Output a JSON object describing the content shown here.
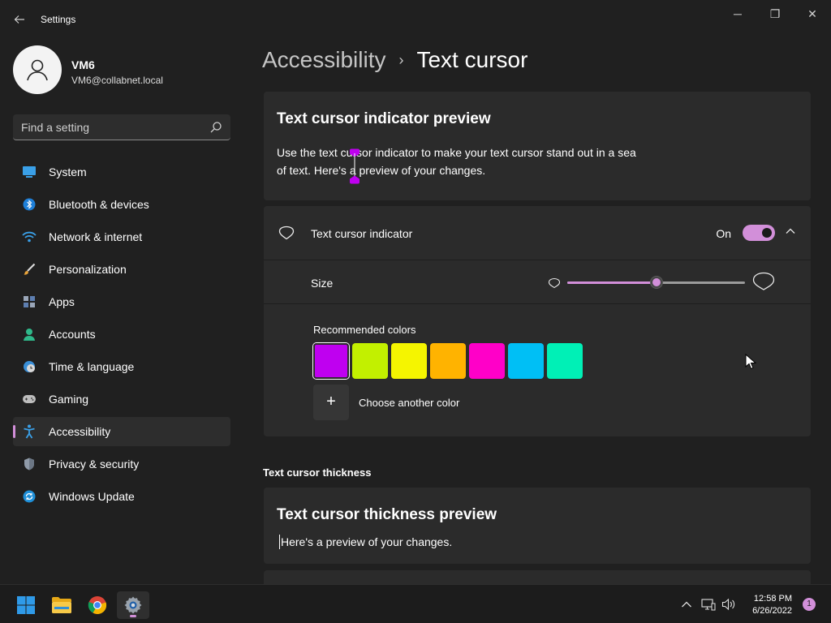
{
  "window": {
    "title": "Settings",
    "back_icon": "back-arrow-icon",
    "minimize_glyph": "─",
    "maximize_glyph": "❐",
    "close_glyph": "✕"
  },
  "profile": {
    "name": "VM6",
    "email": "VM6@collabnet.local"
  },
  "search": {
    "placeholder": "Find a setting"
  },
  "sidebar": {
    "items": [
      {
        "label": "System",
        "icon": "system-icon"
      },
      {
        "label": "Bluetooth & devices",
        "icon": "bluetooth-icon"
      },
      {
        "label": "Network & internet",
        "icon": "network-icon"
      },
      {
        "label": "Personalization",
        "icon": "brush-icon"
      },
      {
        "label": "Apps",
        "icon": "apps-icon"
      },
      {
        "label": "Accounts",
        "icon": "accounts-icon"
      },
      {
        "label": "Time & language",
        "icon": "clock-globe-icon"
      },
      {
        "label": "Gaming",
        "icon": "gamepad-icon"
      },
      {
        "label": "Accessibility",
        "icon": "accessibility-icon",
        "selected": true
      },
      {
        "label": "Privacy & security",
        "icon": "shield-icon"
      },
      {
        "label": "Windows Update",
        "icon": "update-icon"
      }
    ]
  },
  "breadcrumb": {
    "parent": "Accessibility",
    "separator": "›",
    "current": "Text cursor"
  },
  "preview_card": {
    "title": "Text cursor indicator preview",
    "line1": "Use the text cursor indicator to make your text cursor stand out in a sea",
    "line2": "of text. Here's a preview of your changes."
  },
  "indicator_row": {
    "label": "Text cursor indicator",
    "state_text": "On",
    "enabled": true
  },
  "size_row": {
    "label": "Size",
    "value_fraction": 0.5
  },
  "colors": {
    "label": "Recommended colors",
    "swatches": [
      "#bf00f0",
      "#c2f000",
      "#f5f500",
      "#ffb300",
      "#ff00c8",
      "#00bff5",
      "#00f0b6"
    ],
    "selected_index": 0,
    "add_glyph": "+",
    "choose_another": "Choose another color"
  },
  "thickness": {
    "section_header": "Text cursor thickness",
    "preview_title": "Text cursor thickness preview",
    "preview_text": "Here's a preview of your changes."
  },
  "taskbar": {
    "time": "12:58 PM",
    "date": "6/26/2022",
    "notification_count": "1"
  },
  "colors_theme": {
    "accent": "#d28fd9",
    "background": "#202020",
    "card": "#2b2b2b"
  }
}
